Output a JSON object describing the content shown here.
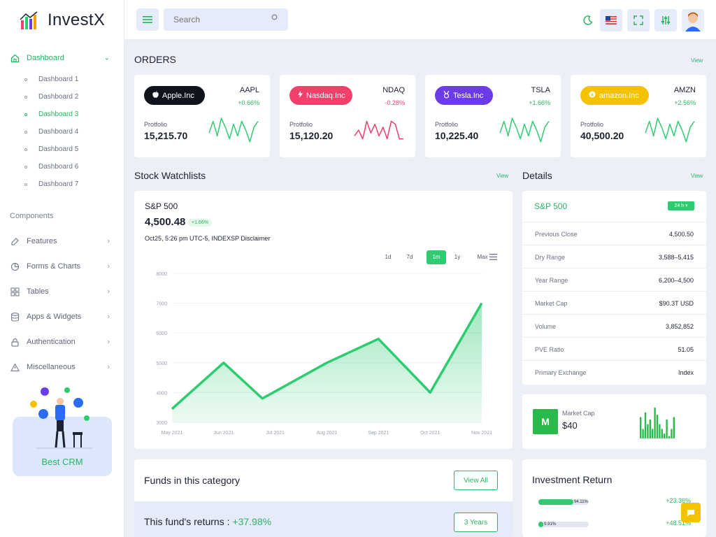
{
  "app": {
    "name": "InvestX"
  },
  "sidebar": {
    "dashboard_label": "Dashboard",
    "sub_items": [
      "Dashboard 1",
      "Dashboard 2",
      "Dashboard 3",
      "Dashboard 4",
      "Dashboard 5",
      "Dashboard 6",
      "Dashboard 7"
    ],
    "active_sub": 2,
    "section_label": "Components",
    "items": [
      {
        "label": "Features",
        "icon": "edit-icon"
      },
      {
        "label": "Forms & Charts",
        "icon": "chart-pie-icon"
      },
      {
        "label": "Tables",
        "icon": "grid-icon"
      },
      {
        "label": "Apps & Widgets",
        "icon": "database-icon"
      },
      {
        "label": "Authentication",
        "icon": "lock-icon"
      },
      {
        "label": "Miscellaneous",
        "icon": "warning-icon"
      }
    ],
    "promo_label": "Best CRM"
  },
  "topbar": {
    "search_placeholder": "Search"
  },
  "orders": {
    "title": "ORDERS",
    "view_label": "View",
    "stocks": [
      {
        "name": "Apple.Inc",
        "ticker": "AAPL",
        "change": "+0.66%",
        "portfolio_label": "Protfolio",
        "portfolio": "15,215.70",
        "color": "#10121c",
        "line": "#2ecc71",
        "icon": "apple-icon",
        "trend": [
          4,
          8,
          3,
          9,
          6,
          2,
          7,
          3,
          8,
          5,
          1,
          6,
          8
        ]
      },
      {
        "name": "Nasdaq.Inc",
        "ticker": "NDAQ",
        "change": "-0.28%",
        "portfolio_label": "Protfolio",
        "portfolio": "15,120.20",
        "color": "#f43f6a",
        "line": "#f43f6a",
        "icon": "bolt-icon",
        "trend": [
          3,
          5,
          2,
          8,
          4,
          7,
          3,
          6,
          2,
          8,
          7,
          2,
          2
        ]
      },
      {
        "name": "Tesla.Inc",
        "ticker": "TSLA",
        "change": "+1.66%",
        "portfolio_label": "Protfolio",
        "portfolio": "10,225.40",
        "color": "#6b3bea",
        "line": "#2ecc71",
        "icon": "medal-icon",
        "trend": [
          4,
          8,
          3,
          9,
          6,
          2,
          7,
          3,
          8,
          5,
          1,
          6,
          8
        ]
      },
      {
        "name": "amazon.Inc",
        "ticker": "AMZN",
        "change": "+2.56%",
        "portfolio_label": "Protfolio",
        "portfolio": "40,500.20",
        "color": "#f5c200",
        "line": "#2ecc71",
        "icon": "amazon-icon",
        "trend": [
          4,
          8,
          3,
          9,
          6,
          2,
          7,
          3,
          8,
          5,
          1,
          6,
          8
        ]
      }
    ]
  },
  "watchlist": {
    "title": "Stock Watchlists",
    "view_label": "View",
    "index_name": "S&P 500",
    "price": "4,500.48",
    "change": "+1.66%",
    "timestamp": "Oct25, 5:26 pm UTC-5, INDEXSP Disclaimer",
    "ranges": [
      "1d",
      "7d",
      "1m",
      "1y",
      "Max"
    ],
    "active_range": 2
  },
  "details": {
    "title": "Details",
    "view_label": "View",
    "index_name": "S&P 500",
    "period": "24 h ▾",
    "rows": [
      {
        "label": "Previous Close",
        "value": "4,500.50"
      },
      {
        "label": "Dry Range",
        "value": "3,588–5,415"
      },
      {
        "label": "Year Range",
        "value": "6,200–4,500"
      },
      {
        "label": "Market Cap",
        "value": "$90.3T USD"
      },
      {
        "label": "Volume",
        "value": "3,852,852"
      },
      {
        "label": "PVE Ratio",
        "value": "51.05"
      },
      {
        "label": "Primary Exchange",
        "value": "Index"
      }
    ]
  },
  "market_cap": {
    "letter": "M",
    "label": "Market Cap",
    "value": "$40",
    "bars": [
      9,
      4,
      11,
      6,
      8,
      4,
      13,
      10,
      6,
      4,
      2,
      8,
      1,
      4,
      9
    ]
  },
  "funds": {
    "title": "Funds in this category",
    "view_all": "View All",
    "returns_label": "This fund's returns : ",
    "returns_value": "+37.98%",
    "period_btn": "3 Years"
  },
  "investment": {
    "title": "Investment Return",
    "rows": [
      {
        "bar_label": "94.11%",
        "fill": 0.6941,
        "pct": "+23.36%"
      },
      {
        "bar_label": "9.91%",
        "fill": 0.0991,
        "pct": "+48.51%"
      }
    ]
  },
  "chart_data": {
    "type": "area",
    "title": "",
    "xlabel": "",
    "ylabel": "",
    "categories": [
      "May 2021",
      "Jun 2021",
      "Jul 2021",
      "Aug 2021",
      "Sep 2021",
      "Oct 2021",
      "Nov 2021"
    ],
    "x_points": [
      0,
      1,
      2,
      3,
      4,
      5,
      6
    ],
    "series": [
      {
        "values": [
          3450,
          5000,
          3800,
          5000,
          5800,
          4000,
          7000
        ],
        "points_x": [
          0,
          1,
          1.75,
          3,
          4,
          5,
          6
        ]
      }
    ],
    "ylim": [
      3000,
      8000
    ],
    "yticks": [
      3000,
      4000,
      5000,
      6000,
      7000,
      8000
    ],
    "color": "#2ecc71",
    "grid": true
  }
}
